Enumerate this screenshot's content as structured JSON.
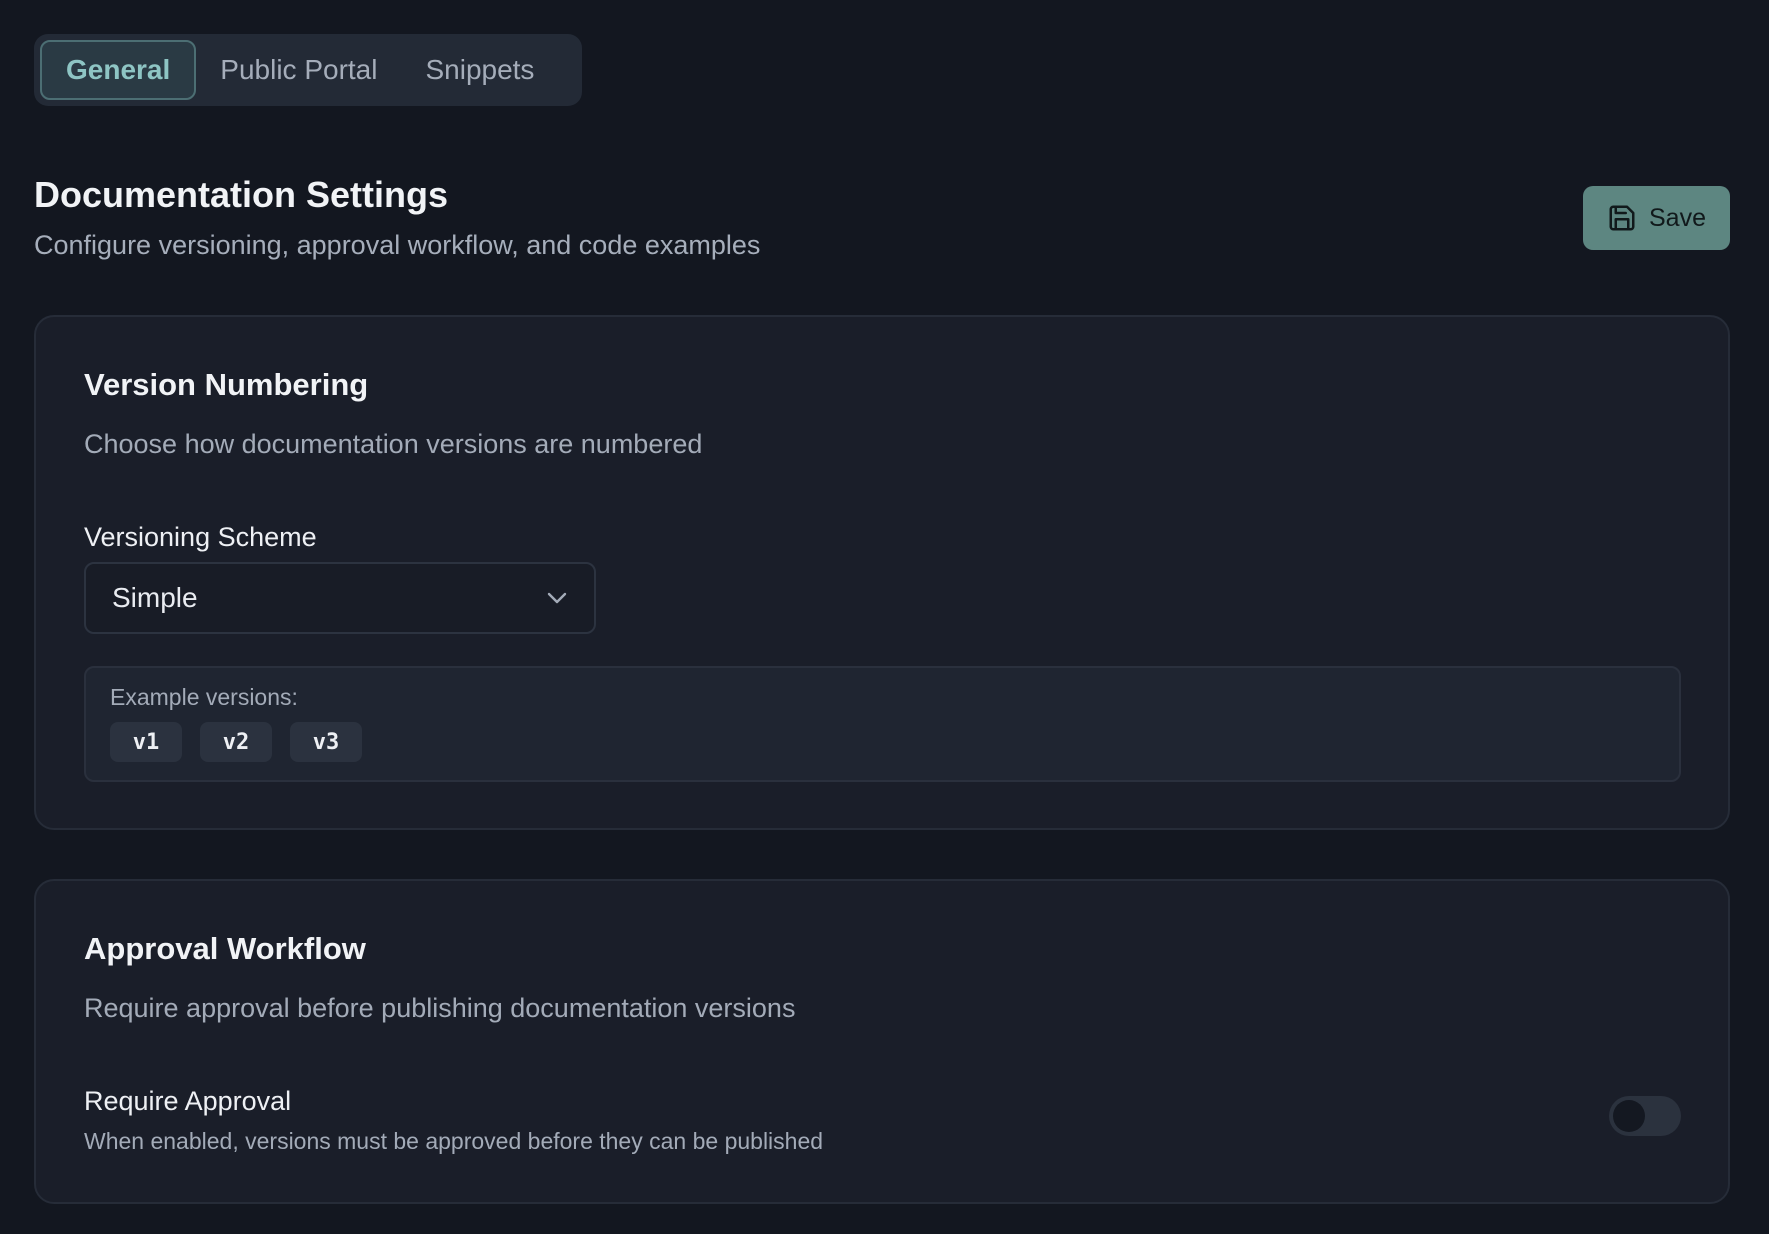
{
  "tabs": [
    {
      "label": "General",
      "active": true
    },
    {
      "label": "Public Portal",
      "active": false
    },
    {
      "label": "Snippets",
      "active": false
    }
  ],
  "header": {
    "title": "Documentation Settings",
    "subtitle": "Configure versioning, approval workflow, and code examples",
    "save_label": "Save",
    "save_icon": "save-icon"
  },
  "version_numbering": {
    "title": "Version Numbering",
    "description": "Choose how documentation versions are numbered",
    "scheme_label": "Versioning Scheme",
    "scheme_value": "Simple",
    "examples_label": "Example versions:",
    "examples": [
      "v1",
      "v2",
      "v3"
    ]
  },
  "approval_workflow": {
    "title": "Approval Workflow",
    "description": "Require approval before publishing documentation versions",
    "require_label": "Require Approval",
    "require_hint": "When enabled, versions must be approved before they can be published",
    "require_enabled": false
  },
  "colors": {
    "background": "#131720",
    "card": "#1a1e29",
    "accent": "#5d8681",
    "active_tab_text": "#8ec5c4"
  }
}
